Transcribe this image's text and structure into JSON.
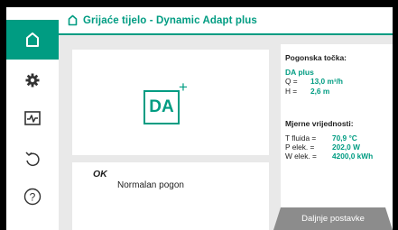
{
  "header": {
    "title": "Grijaće tijelo - Dynamic Adapt plus",
    "icon": "home-icon"
  },
  "sidebar": {
    "items": [
      {
        "icon": "home-icon",
        "active": true
      },
      {
        "icon": "gear-icon",
        "active": false
      },
      {
        "icon": "diagnostics-icon",
        "active": false
      },
      {
        "icon": "undo-icon",
        "active": false
      },
      {
        "icon": "help-icon",
        "active": false
      }
    ],
    "help_glyph": "?"
  },
  "mode_tile": {
    "label": "DA",
    "plus": "+"
  },
  "status": {
    "code": "OK",
    "message": "Normalan pogon"
  },
  "info": {
    "operating_point": {
      "title": "Pogonska točka:",
      "mode": "DA plus",
      "rows": [
        {
          "label": "Q =",
          "value": "13,0 m³/h"
        },
        {
          "label": "H =",
          "value": "2,6 m"
        }
      ]
    },
    "measurements": {
      "title": "Mjerne vrijednosti:",
      "rows": [
        {
          "label": "T fluida =",
          "value": "70,9 °C"
        },
        {
          "label": "P elek. =",
          "value": "202,0 W"
        },
        {
          "label": "W elek. =",
          "value": "4200,0 kWh"
        }
      ]
    }
  },
  "more_button": {
    "label": "Daljnje postavke"
  },
  "colors": {
    "accent": "#009c82",
    "panel_bg": "#e9e9e9",
    "button_bg": "#8c8c8c",
    "frame": "#000000"
  }
}
